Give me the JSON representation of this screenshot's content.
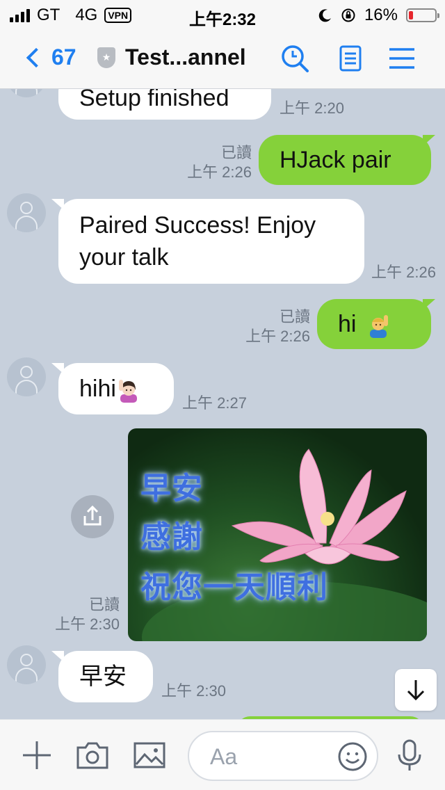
{
  "status_bar": {
    "carrier": "GT",
    "network": "4G",
    "vpn": "VPN",
    "time": "上午2:32",
    "battery_text": "16%",
    "battery_level": 0.16,
    "battery_color": "#e6262d"
  },
  "nav": {
    "back_count": "67",
    "title": "Test...annel",
    "accent_color": "#1f7ff0",
    "icons": [
      "chevron-left-icon",
      "shield-icon",
      "search-icon",
      "notes-icon",
      "menu-icon"
    ]
  },
  "messages": [
    {
      "direction": "in",
      "text": "Setup finished",
      "time": "上午 2:20"
    },
    {
      "direction": "out",
      "text": "HJack pair",
      "read": "已讀",
      "time": "上午 2:26"
    },
    {
      "direction": "in",
      "text": "Paired Success! Enjoy your talk",
      "line1": "Paired Success! Enjoy",
      "line2": "your talk",
      "time": "上午 2:26"
    },
    {
      "direction": "out",
      "text": "hi",
      "emoji": "raising-hand-man-emoji",
      "read": "已讀",
      "time": "上午 2:26"
    },
    {
      "direction": "in",
      "text": "hihi",
      "emoji": "raising-hand-woman-emoji",
      "time": "上午 2:27"
    },
    {
      "direction": "out",
      "type": "image",
      "image_lines": [
        "早安",
        "感謝",
        "祝您一天順利"
      ],
      "read": "已讀",
      "time": "上午 2:30"
    },
    {
      "direction": "in",
      "text": "早安",
      "time": "上午 2:30"
    }
  ],
  "input": {
    "placeholder": "Aa",
    "icons": [
      "plus-icon",
      "camera-icon",
      "image-icon",
      "smiley-icon",
      "microphone-icon"
    ]
  },
  "colors": {
    "chat_background": "#c7d0dc",
    "outgoing_bubble": "#85d13a",
    "incoming_bubble": "#ffffff"
  }
}
